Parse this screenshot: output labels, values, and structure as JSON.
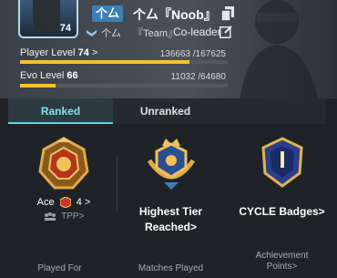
{
  "player": {
    "avatar_level": "74",
    "tag_chip": "个厶",
    "name": "个厶『Noob』",
    "team": "『Team』",
    "tag_small": "个厶",
    "role": "Co-leader"
  },
  "progress": {
    "player_level_label": "Player Level",
    "player_level_value": "74",
    "player_level_arrow": ">",
    "player_xp": "136663 /167625",
    "player_fraction": 0.815,
    "evo_level_label": "Evo Level",
    "evo_level_value": "66",
    "evo_xp": "11032 /64680",
    "evo_fraction": 0.17
  },
  "tabs": [
    {
      "label": "Ranked",
      "active": true
    },
    {
      "label": "Unranked",
      "active": false
    }
  ],
  "ranked": {
    "tier_name": "Ace",
    "tier_stars": "4",
    "tier_arrow": ">",
    "mode": "TPP>",
    "highest_tier_label_1": "Highest Tier",
    "highest_tier_label_2": "Reached>",
    "cycle_badges_label": "CYCLE Badges>"
  },
  "footer": {
    "played_for": "Played For",
    "matches_played": "Matches Played",
    "achievement_1": "Achievement",
    "achievement_2": "Points>"
  },
  "colors": {
    "accent_cyan": "#5fd3d8",
    "bar_yellow": "#f1c232",
    "tag_blue": "#3c7fb4"
  }
}
